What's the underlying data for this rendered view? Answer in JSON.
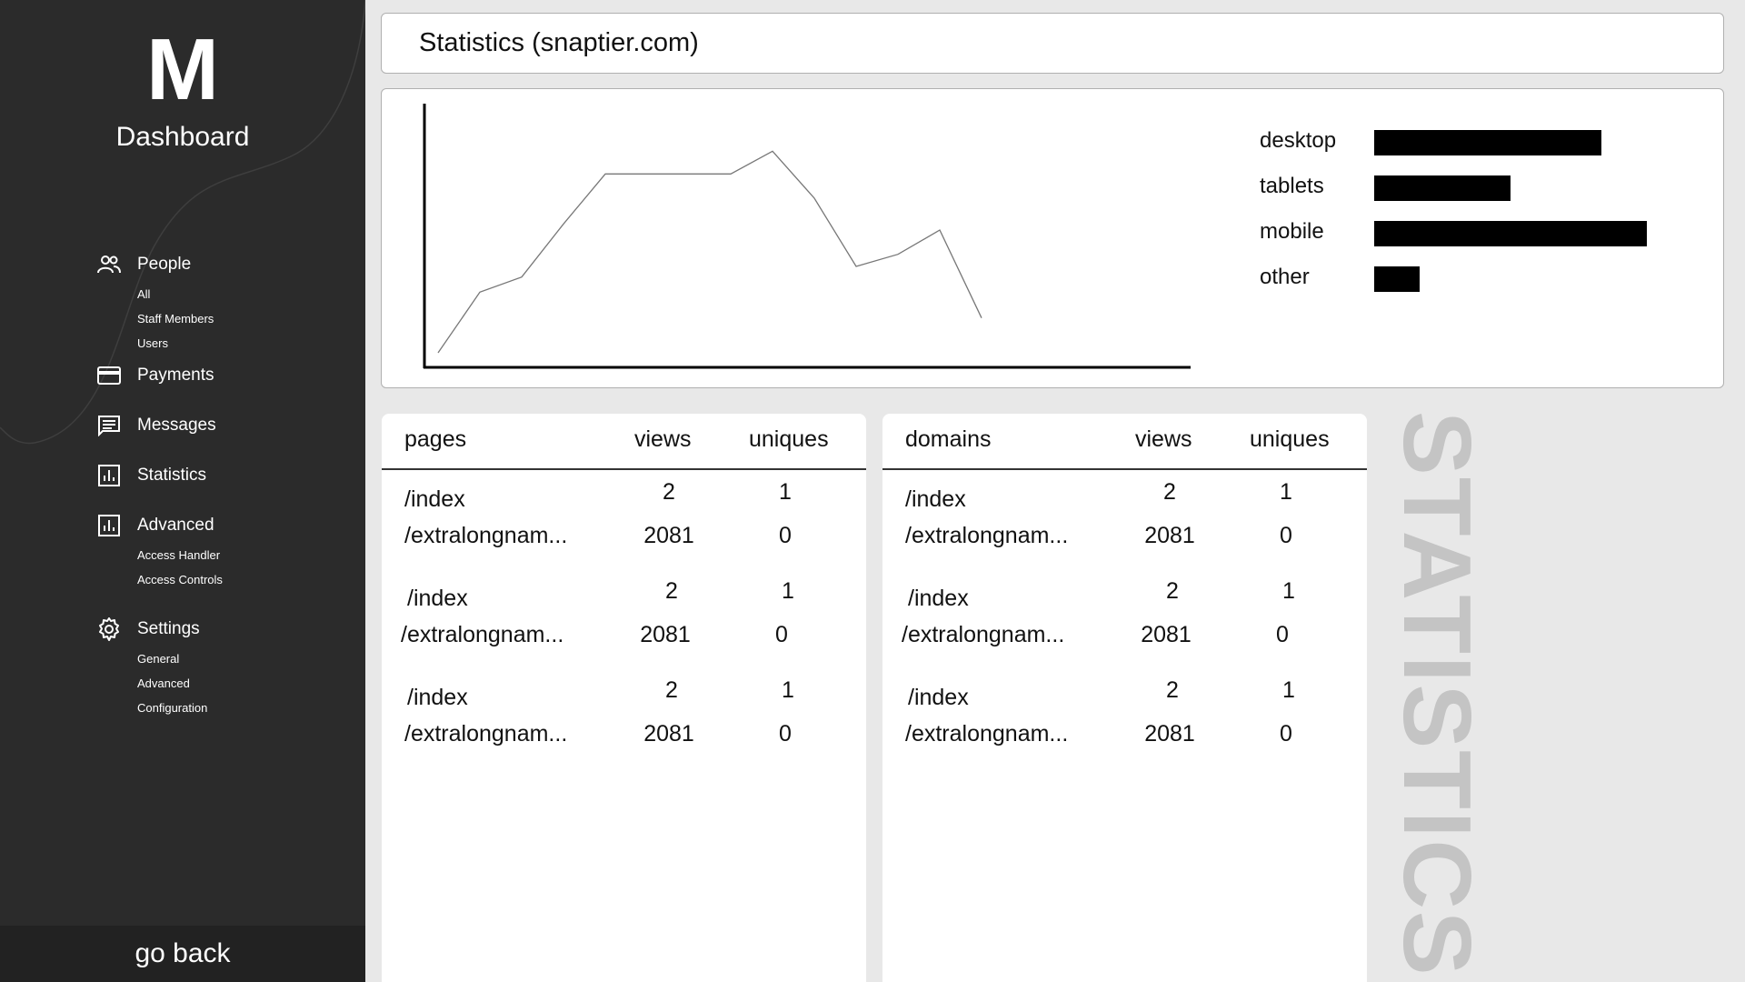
{
  "sidebar": {
    "logo": "M",
    "title": "Dashboard",
    "groups": [
      {
        "icon": "people-icon",
        "label": "People",
        "items": [
          "All",
          "Staff Members",
          "Users"
        ]
      },
      {
        "icon": "credit-card-icon",
        "label": "Payments",
        "items": []
      },
      {
        "icon": "message-icon",
        "label": "Messages",
        "items": []
      },
      {
        "icon": "bar-chart-icon",
        "label": "Statistics",
        "items": []
      },
      {
        "icon": "bar-chart-icon",
        "label": "Advanced",
        "items": [
          "Access Handler",
          "Access Controls"
        ]
      },
      {
        "icon": "gear-icon",
        "label": "Settings",
        "items": [
          "General",
          "Advanced",
          "Configuration"
        ]
      }
    ],
    "go_back": "go back"
  },
  "header": {
    "title": "Statistics (snaptier.com)"
  },
  "chart_data": [
    {
      "type": "line",
      "title": "",
      "xlabel": "",
      "ylabel": "",
      "x": [
        0,
        1,
        2,
        3,
        4,
        5,
        6,
        7,
        8,
        9,
        10,
        11,
        12
      ],
      "series": [
        {
          "values": [
            0,
            4,
            5,
            8.5,
            11.8,
            11.8,
            11.8,
            11.8,
            13.3,
            10.2,
            5.7,
            6.5,
            8.1,
            2.3
          ]
        }
      ],
      "grid": false
    },
    {
      "type": "bar",
      "orientation": "horizontal",
      "categories": [
        "desktop",
        "tablets",
        "mobile",
        "other"
      ],
      "values": [
        250,
        150,
        300,
        50
      ]
    }
  ],
  "pages_table": {
    "headers": [
      "pages",
      "views",
      "uniques"
    ],
    "rows": [
      [
        "/index",
        "2",
        "1"
      ],
      [
        "/extralongnam...",
        "2081",
        "0"
      ],
      [
        "/index",
        "2",
        "1"
      ],
      [
        "/extralongnam...",
        "2081",
        "0"
      ],
      [
        "/index",
        "2",
        "1"
      ],
      [
        "/extralongnam...",
        "2081",
        "0"
      ]
    ]
  },
  "domains_table": {
    "headers": [
      "domains",
      "views",
      "uniques"
    ],
    "rows": [
      [
        "/index",
        "2",
        "1"
      ],
      [
        "/extralongnam...",
        "2081",
        "0"
      ],
      [
        "/index",
        "2",
        "1"
      ],
      [
        "/extralongnam...",
        "2081",
        "0"
      ],
      [
        "/index",
        "2",
        "1"
      ],
      [
        "/extralongnam...",
        "2081",
        "0"
      ]
    ]
  },
  "watermark": "STATISTICS"
}
